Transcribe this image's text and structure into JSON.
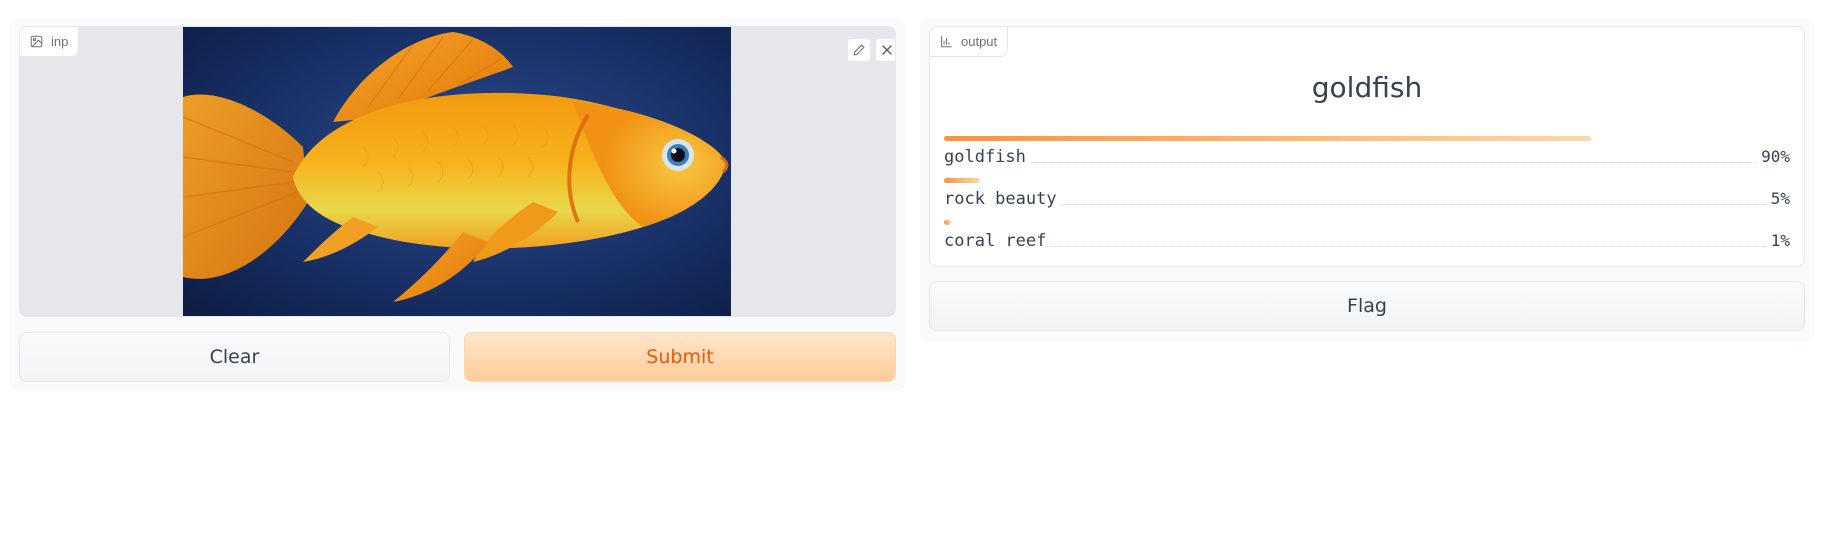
{
  "input": {
    "label": "inp",
    "icon": "image-icon",
    "edit_icon": "pencil-icon",
    "clear_icon": "close-icon"
  },
  "buttons": {
    "clear_label": "Clear",
    "submit_label": "Submit",
    "flag_label": "Flag"
  },
  "output": {
    "label": "output",
    "icon": "bar-chart-icon",
    "title": "goldfish",
    "confidences": [
      {
        "label": "goldfish",
        "value": 0.9,
        "display": "90%"
      },
      {
        "label": "rock beauty",
        "value": 0.05,
        "display": "5%"
      },
      {
        "label": "coral reef",
        "value": 0.01,
        "display": "1%"
      }
    ]
  },
  "colors": {
    "accent": "#ea580c",
    "accent_light": "#ffcc99",
    "bar": "#fb923c"
  }
}
